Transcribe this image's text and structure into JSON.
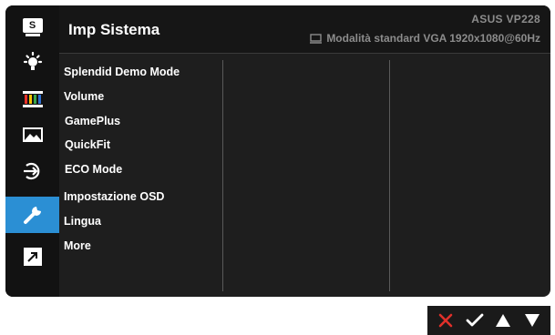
{
  "header": {
    "title": "Imp Sistema",
    "model": "ASUS  VP228",
    "mode_info": "Modalità standard VGA 1920x1080@60Hz"
  },
  "sidebar": {
    "items": [
      {
        "icon": "splendid-s-icon",
        "label": "S"
      },
      {
        "icon": "brightness-icon"
      },
      {
        "icon": "color-bars-icon"
      },
      {
        "icon": "image-icon"
      },
      {
        "icon": "input-select-icon"
      },
      {
        "icon": "wrench-icon",
        "active": true
      },
      {
        "icon": "shortcut-arrow-icon"
      }
    ]
  },
  "menu": {
    "items": [
      "Splendid Demo Mode",
      "Volume",
      "GamePlus",
      "QuickFit",
      "ECO Mode",
      "Impostazione OSD",
      "Lingua",
      "More"
    ]
  },
  "nav": {
    "buttons": [
      "close-x-icon",
      "confirm-check-icon",
      "up-arrow-icon",
      "down-arrow-icon"
    ]
  },
  "colors": {
    "accent": "#2b8fd4",
    "close_red": "#e0302a",
    "panel_bg": "#1e1e1e"
  }
}
